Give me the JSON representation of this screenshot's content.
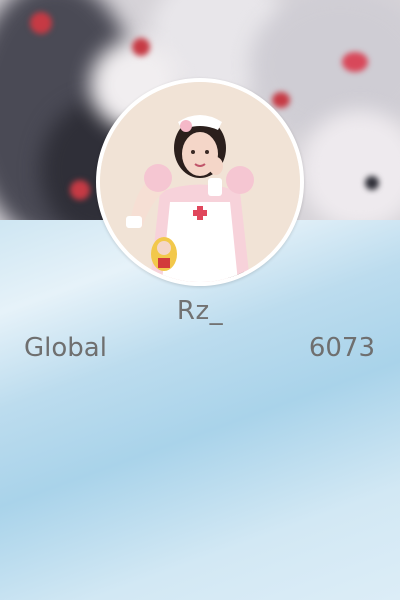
{
  "profile": {
    "username": "Rz_",
    "region": "Global",
    "score": "6073"
  },
  "icons": {
    "avatar": "user-avatar-photo",
    "cover": "profile-cover-image"
  }
}
